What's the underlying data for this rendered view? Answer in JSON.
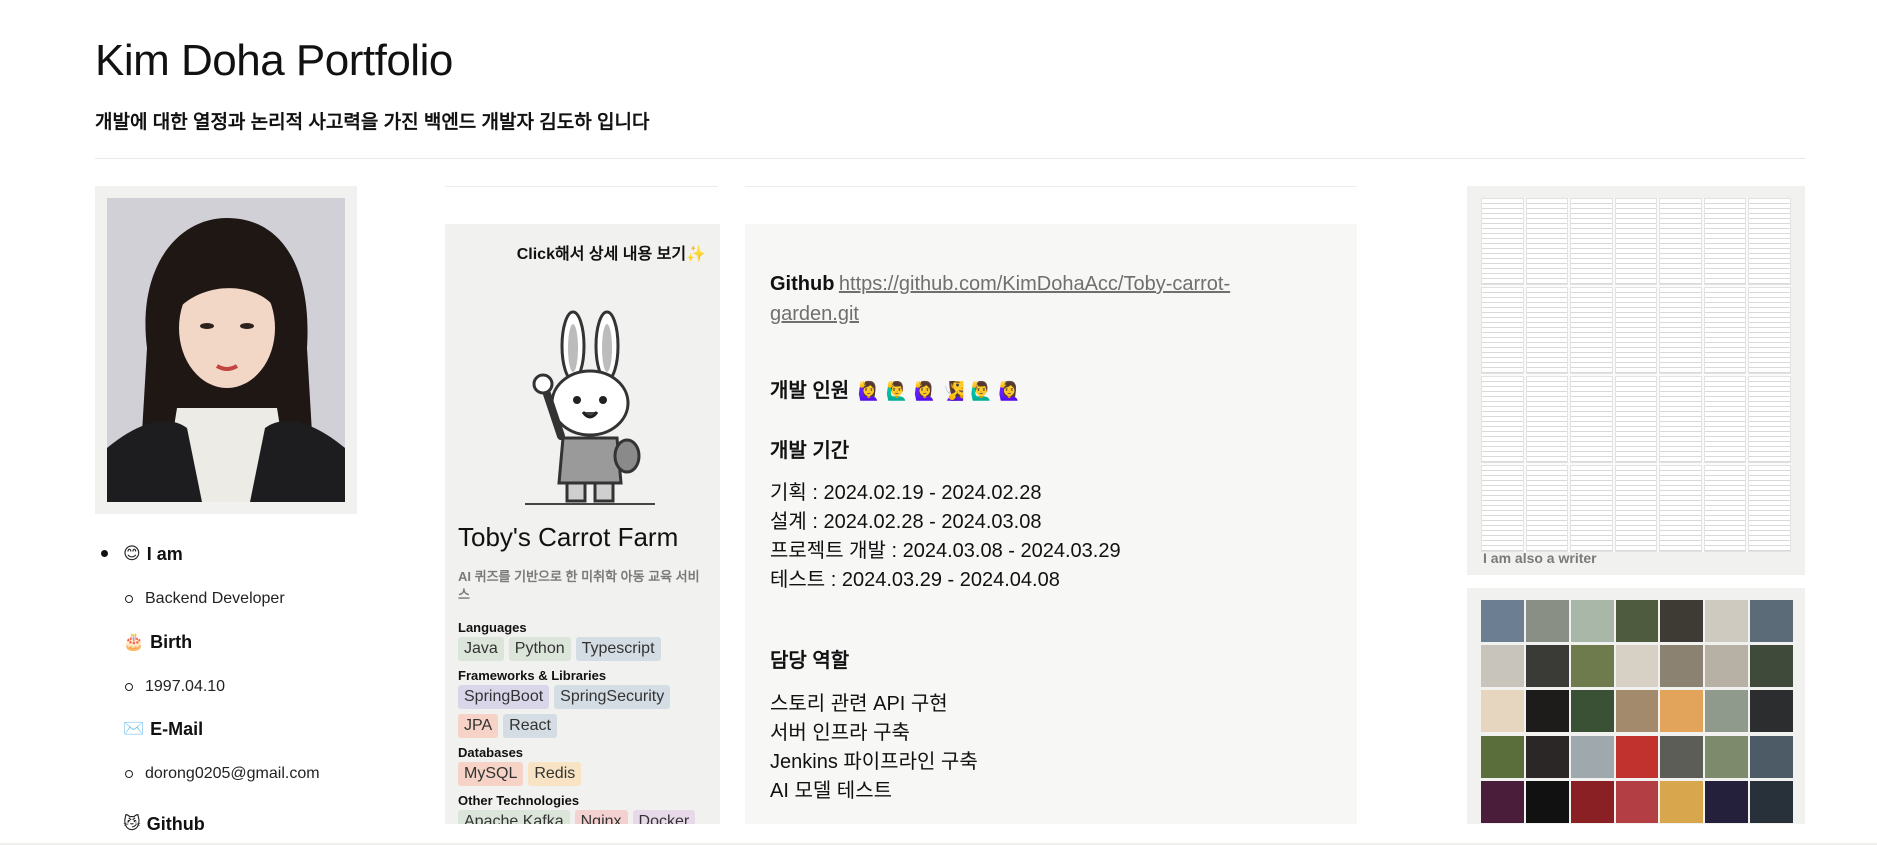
{
  "header": {
    "title": "Kim Doha Portfolio",
    "subtitle": "개발에 대한 열정과 논리적 사고력을 가진 백엔드 개발자 김도하 입니다"
  },
  "profile": {
    "items": [
      {
        "emoji": "😊",
        "label": "I am",
        "value": "Backend Developer"
      },
      {
        "emoji": "🎂",
        "label": "Birth",
        "value": "1997.04.10"
      },
      {
        "emoji": "✉️",
        "label": "E-Mail",
        "value": "dorong0205@gmail.com"
      },
      {
        "emoji": "😼",
        "label": "Github",
        "value": ""
      }
    ]
  },
  "project": {
    "hint": "Click해서 상세 내용 보기✨",
    "title": "Toby's Carrot Farm",
    "description": "AI 퀴즈를 기반으로 한 미취학 아동 교육 서비스",
    "groups": [
      {
        "label": "Languages",
        "tags": [
          {
            "name": "Java",
            "color": "#dbe5d9"
          },
          {
            "name": "Python",
            "color": "#dbe5d9"
          },
          {
            "name": "Typescript",
            "color": "#d4dde3"
          }
        ]
      },
      {
        "label": "Frameworks & Libraries",
        "tags": [
          {
            "name": "SpringBoot",
            "color": "#d9d6ea"
          },
          {
            "name": "SpringSecurity",
            "color": "#d4dde3"
          },
          {
            "name": "JPA",
            "color": "#f6d3c6"
          },
          {
            "name": "React",
            "color": "#d4dde3"
          }
        ]
      },
      {
        "label": "Databases",
        "tags": [
          {
            "name": "MySQL",
            "color": "#f6d3c6"
          },
          {
            "name": "Redis",
            "color": "#f8e4c4"
          }
        ]
      },
      {
        "label": "Other Technologies",
        "tags": [
          {
            "name": "Apache Kafka",
            "color": "#dbe5d9"
          },
          {
            "name": "Nginx",
            "color": "#f4d1d1"
          },
          {
            "name": "Docker",
            "color": "#e7d8ea"
          }
        ]
      }
    ]
  },
  "detail": {
    "github_label": "Github",
    "github_url_line1": "https://github.com/KimDohaAcc/Toby-carrot-",
    "github_url_line2": "garden.git",
    "team_label": "개발 인원",
    "team_emojis": "🙋‍♀️ 🙋‍♂️ 🙋‍♀️ 🧏‍♀️ 🙋‍♂️ 🙋‍♀️",
    "period_label": "개발 기간",
    "periods": [
      "기획 : 2024.02.19 - 2024.02.28",
      "설계 : 2024.02.28 - 2024.03.08",
      "프로젝트 개발 : 2024.03.08 - 2024.03.29",
      "테스트 : 2024.03.29 - 2024.04.08"
    ],
    "role_label": "담당 역할",
    "roles": [
      "스토리 관련 API 구현",
      "서버 인프라 구축",
      "Jenkins 파이프라인 구축",
      "AI 모델 테스트"
    ]
  },
  "gallery": {
    "caption": "I am also a writer"
  },
  "photos": {
    "colors": [
      "#6c7e91",
      "#8a8f86",
      "#a9b7a8",
      "#4e5b3f",
      "#3d3b33",
      "#cfcac0",
      "#5b6b78",
      "#c8c3bb",
      "#3a3a36",
      "#6e7b4d",
      "#d7d0c4",
      "#8c8272",
      "#b7b0a4",
      "#3f4a3a",
      "#e6d6c0",
      "#1e1c1a",
      "#3b5136",
      "#a38a6d",
      "#e1a45a",
      "#8f9a8d",
      "#2c2d2f",
      "#5a6e3c",
      "#2a2726",
      "#9ea8ad",
      "#c1312d",
      "#5d5d58",
      "#7e8a6c",
      "#4d5b66",
      "#4a1e3a",
      "#111111",
      "#8a1f24",
      "#b33f44",
      "#d7a64d",
      "#241f3a",
      "#28303a"
    ]
  }
}
